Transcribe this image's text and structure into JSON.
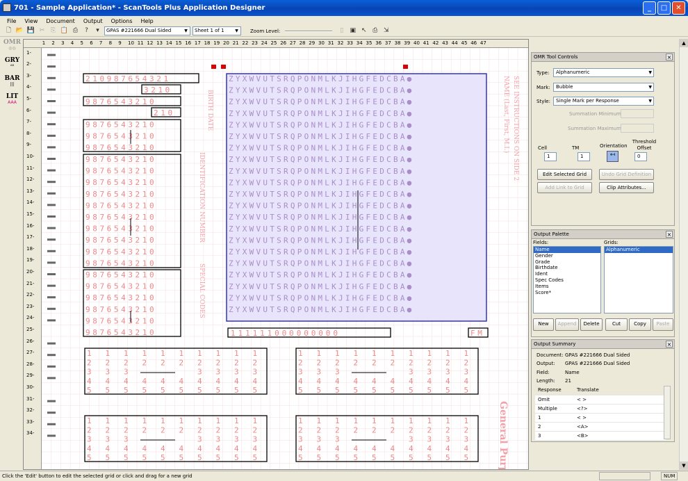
{
  "window": {
    "title": "701 - Sample Application* - ScanTools Plus Application Designer",
    "buttons": [
      "_",
      "□",
      "✕"
    ]
  },
  "menu": [
    "File",
    "View",
    "Document",
    "Output",
    "Options",
    "Help"
  ],
  "toolbar": {
    "icons": [
      "new-icon",
      "open-icon",
      "save-icon",
      "cut-icon",
      "copy-icon",
      "paste-icon",
      "print-icon",
      "help-icon",
      "more-icon"
    ],
    "document_combo": "GPAS #221666 Dual Sided",
    "sheet_combo": "Sheet 1 of 1",
    "zoom_label": "Zoom Level:",
    "right_icons": [
      "page-icon",
      "clipboard-icon",
      "pointer-icon",
      "print-preview-icon",
      "export-icon"
    ]
  },
  "left_tools": [
    {
      "label": "OMR",
      "sub": "◎◎"
    },
    {
      "label": "GRY",
      "sub": "ᴬᴮ"
    },
    {
      "label": "BAR",
      "sub": "|||"
    },
    {
      "label": "LIT",
      "sub": "AAA"
    }
  ],
  "form": {
    "letters_row": "Z Y X W V U T S R Q P O N M L K J I H G F E D C B A ●",
    "digits_row": "9 8 7 6 5 4 3 2 1 0",
    "first_row": "2 1 0 9 8 7 6 5 4 3 2 1",
    "three_row": "3 2 1 0",
    "two_row": "2 1 0",
    "id_row": "1 1 1 1 1 1 0 0 0 0 0 0 0 0 0",
    "gender_row": "F M",
    "col_digits": [
      "1",
      "2",
      "3",
      "4",
      "5"
    ],
    "side_text_1": "SEE INSTRUCTIONS ON SIDE 2",
    "side_text_2": "NAME (Last, First, M.I.)",
    "birth_text": "BIRTH DATE",
    "ident_text": "IDENTIFICATION NUMBER",
    "special_text": "SPECIAL CODES",
    "general_text": "General Purpo"
  },
  "omr_panel": {
    "title": "OMR Tool Controls",
    "type_label": "Type:",
    "type_value": "Alphanumeric",
    "mark_label": "Mark:",
    "mark_value": "Bubble",
    "style_label": "Style:",
    "style_value": "Single Mark per Response",
    "sum_min_label": "Summation Minimum:",
    "sum_max_label": "Summation Maximum:",
    "cell_label": "Cell",
    "cell_value": "1",
    "tm_label": "TM",
    "tm_value": "1",
    "orientation_label": "Orientation",
    "threshold_label": "Threshold Offset",
    "threshold_value": "0",
    "edit_btn": "Edit Selected Grid",
    "undo_btn": "Undo Grid Definition",
    "add_link_btn": "Add Link to Grid",
    "clip_btn": "Clip Attributes..."
  },
  "output_palette": {
    "title": "Output Palette",
    "fields_label": "Fields:",
    "grids_label": "Grids:",
    "fields": [
      "Name",
      "Gender",
      "Grade",
      "Birthdate",
      "Ident",
      "Spec Codes",
      "Items",
      "Score*"
    ],
    "grids": [
      "Alphanumeric"
    ],
    "buttons": [
      "New",
      "Append",
      "Delete",
      "Cut",
      "Copy",
      "Paste"
    ]
  },
  "output_summary": {
    "title": "Output Summary",
    "rows": [
      {
        "k": "Document:",
        "v": "GPAS #221666 Dual Sided"
      },
      {
        "k": "Output:",
        "v": "GPAS #221666 Dual Sided"
      },
      {
        "k": "Field:",
        "v": "Name"
      },
      {
        "k": "Length:",
        "v": "21"
      }
    ],
    "col_response": "Response",
    "col_translate": "Translate",
    "table": [
      {
        "r": "Omit",
        "t": "< >"
      },
      {
        "r": "Multiple",
        "t": "<?>"
      },
      {
        "r": "1",
        "t": "< >"
      },
      {
        "r": "2",
        "t": "<A>"
      },
      {
        "r": "3",
        "t": "<B>"
      }
    ]
  },
  "status": {
    "message": "Click the 'Edit' button to edit the selected grid or click and drag for a new grid",
    "num": "NUM"
  }
}
